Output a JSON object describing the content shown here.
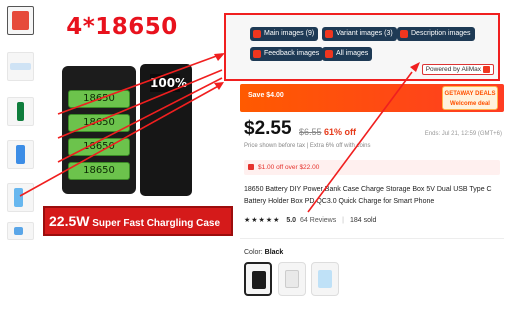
{
  "hero": {
    "title": "4*18650",
    "screen": "100%",
    "battery_label": "18650",
    "banner_big": "22.5W",
    "banner_rest": "Super Fast Chargling Case"
  },
  "overlay": {
    "buttons": [
      "Main images (9)",
      "Variant images (3)",
      "Description images",
      "Feedback images",
      "All images"
    ],
    "powered_by": "Powered by AliMax"
  },
  "deal": {
    "save": "Save $4.00",
    "badge_line1": "GETAWAY DEALS",
    "badge_line2": "Welcome deal"
  },
  "price": {
    "current": "$2.55",
    "original": "$6.55",
    "discount": "61% off",
    "ends": "Ends: Jul 21, 12:59 (GMT+6)",
    "note": "Price shown before tax  |  Extra 6% off with coins"
  },
  "coupon": {
    "text": "$1.00 off over $22.00"
  },
  "product": {
    "title": "18650 Battery DIY Power Bank Case Charge Storage Box 5V Dual USB Type C Battery Holder Box PD QC3.0 Quick Charge for Smart Phone"
  },
  "rating": {
    "stars": "★★★★★",
    "score": "5.0",
    "reviews": "64 Reviews",
    "separator": "|",
    "sold": "184 sold"
  },
  "variant": {
    "label": "Color:",
    "selected": "Black"
  },
  "colors": {
    "brand_red": "#e8121d",
    "accent_orange": "#ff5a00",
    "overlay_button": "#1e3a55"
  }
}
